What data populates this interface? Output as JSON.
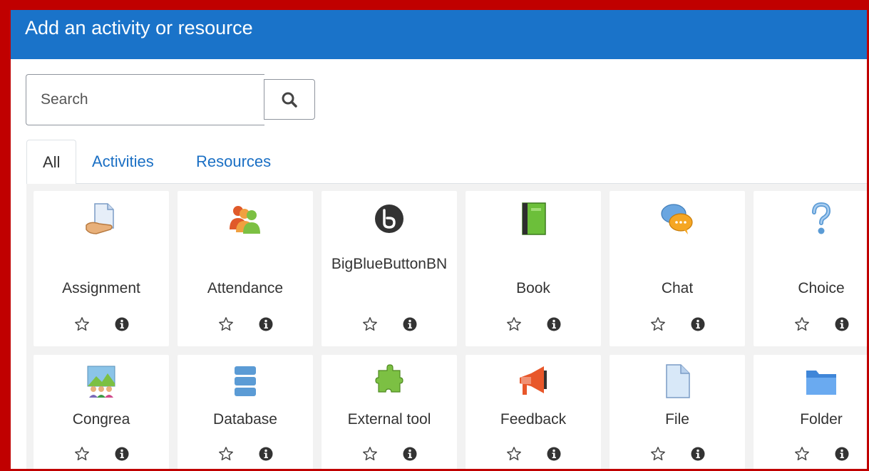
{
  "dialog": {
    "title": "Add an activity or resource"
  },
  "search": {
    "placeholder": "Search"
  },
  "tabs": [
    {
      "label": "All",
      "active": true
    },
    {
      "label": "Activities",
      "active": false
    },
    {
      "label": "Resources",
      "active": false
    }
  ],
  "modules": [
    {
      "name": "Assignment",
      "icon": "assignment-icon"
    },
    {
      "name": "Attendance",
      "icon": "attendance-icon"
    },
    {
      "name": "BigBlueButtonBN",
      "icon": "bigbluebutton-icon"
    },
    {
      "name": "Book",
      "icon": "book-icon"
    },
    {
      "name": "Chat",
      "icon": "chat-icon"
    },
    {
      "name": "Choice",
      "icon": "choice-icon"
    },
    {
      "name": "Congrea",
      "icon": "congrea-icon"
    },
    {
      "name": "Database",
      "icon": "database-icon"
    },
    {
      "name": "External tool",
      "icon": "external-tool-icon"
    },
    {
      "name": "Feedback",
      "icon": "feedback-icon"
    },
    {
      "name": "File",
      "icon": "file-icon"
    },
    {
      "name": "Folder",
      "icon": "folder-icon"
    }
  ],
  "colors": {
    "header": "#1a73c9",
    "border": "#c00000",
    "link": "#1a6fc4"
  }
}
